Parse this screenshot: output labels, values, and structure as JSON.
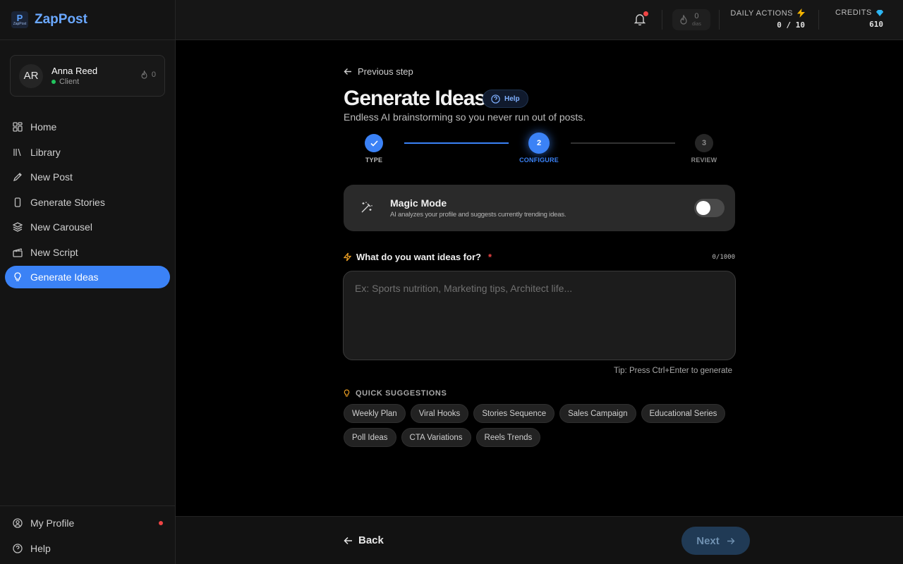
{
  "brand": {
    "name": "ZapPost",
    "logo_text": "ZapPost"
  },
  "user": {
    "initials": "AR",
    "name": "Anna Reed",
    "role": "Client",
    "streak": "0"
  },
  "nav": [
    {
      "label": "Home",
      "icon": "grid-icon"
    },
    {
      "label": "Library",
      "icon": "library-icon"
    },
    {
      "label": "New Post",
      "icon": "pencil-icon"
    },
    {
      "label": "Generate Stories",
      "icon": "phone-icon"
    },
    {
      "label": "New Carousel",
      "icon": "layers-icon"
    },
    {
      "label": "New Script",
      "icon": "clapper-icon"
    },
    {
      "label": "Generate Ideas",
      "icon": "bulb-icon",
      "active": true
    }
  ],
  "sidebar_bottom": [
    {
      "label": "My Profile",
      "icon": "user-circle-icon",
      "notification": true
    },
    {
      "label": "Help",
      "icon": "help-circle-icon"
    }
  ],
  "topbar": {
    "streak_value": "0",
    "streak_unit": "dias",
    "daily_actions_label": "DAILY ACTIONS",
    "daily_actions_value": "0 / 10",
    "credits_label": "CREDITS",
    "credits_value": "610"
  },
  "page": {
    "prev_step": "Previous step",
    "title": "Generate Ideas",
    "help": "Help",
    "subtitle": "Endless AI brainstorming so you never run out of posts."
  },
  "stepper": {
    "steps": [
      {
        "number": "1",
        "label": "TYPE",
        "state": "done"
      },
      {
        "number": "2",
        "label": "CONFIGURE",
        "state": "active"
      },
      {
        "number": "3",
        "label": "REVIEW",
        "state": "pending"
      }
    ]
  },
  "magic_mode": {
    "title": "Magic Mode",
    "description": "AI analyzes your profile and suggests currently trending ideas.",
    "enabled": false
  },
  "question": {
    "label": "What do you want ideas for?",
    "required_mark": "*",
    "counter": "0/1000",
    "placeholder": "Ex: Sports nutrition, Marketing tips, Architect life...",
    "value": "",
    "tip": "Tip: Press Ctrl+Enter to generate"
  },
  "quick_suggestions": {
    "label": "QUICK SUGGESTIONS",
    "items": [
      "Weekly Plan",
      "Viral Hooks",
      "Stories Sequence",
      "Sales Campaign",
      "Educational Series",
      "Poll Ideas",
      "CTA Variations",
      "Reels Trends"
    ]
  },
  "footer": {
    "back": "Back",
    "next": "Next"
  },
  "colors": {
    "accent": "#3b82f6",
    "active_nav": "#3b82f6",
    "danger": "#ef4444",
    "success": "#22c55e",
    "next_disabled": "#203a55"
  }
}
